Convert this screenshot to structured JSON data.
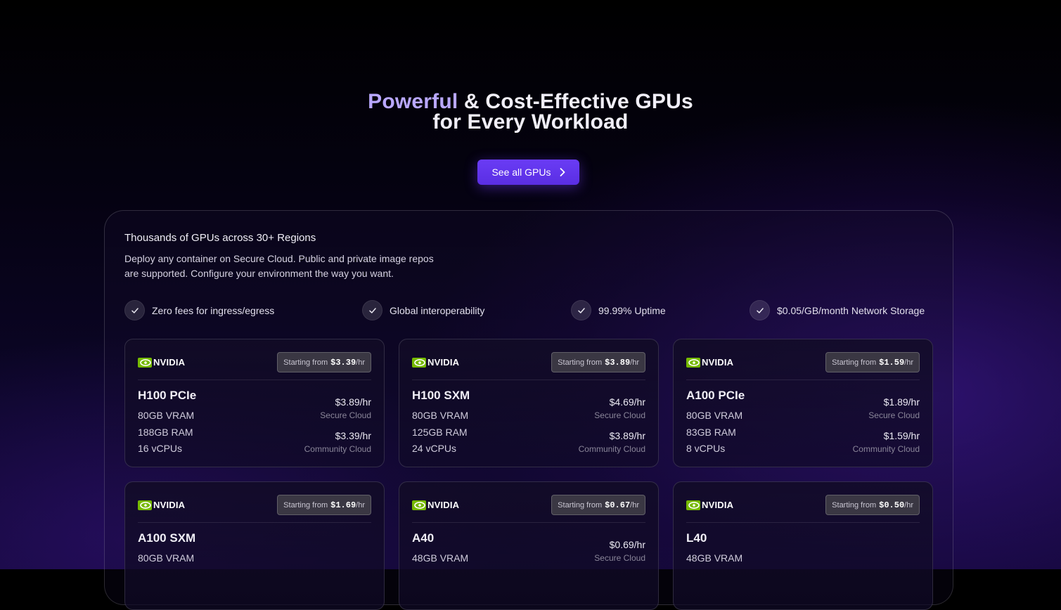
{
  "hero": {
    "title_accent": "Powerful",
    "title_rest": " & Cost-Effective GPUs",
    "title_line2": "for Every Workload",
    "cta_label": "See all GPUs",
    "cta_icon": "chevron-right-icon"
  },
  "panel": {
    "title": "Thousands of GPUs across 30+ Regions",
    "desc_line1": "Deploy any container on Secure Cloud. Public and private image repos",
    "desc_line2": "are supported. Configure your environment the way you want.",
    "features": [
      {
        "label": "Zero fees for ingress/egress",
        "icon": "check-icon"
      },
      {
        "label": "Global interoperability",
        "icon": "check-icon"
      },
      {
        "label": "99.99% Uptime",
        "icon": "check-icon"
      },
      {
        "label": "$0.05/GB/month Network Storage",
        "icon": "check-icon"
      }
    ]
  },
  "brand": {
    "logo_text": "NVIDIA",
    "logo_icon": "nvidia-eye-icon",
    "logo_color": "#76b900",
    "accent": "#6a3cf5"
  },
  "labels": {
    "starting_from": "Starting from",
    "per_hr": "/hr",
    "secure_cloud": "Secure Cloud",
    "community_cloud": "Community Cloud"
  },
  "gpus": [
    {
      "name": "H100 PCIe",
      "starting_price": "$3.39",
      "vram": "80GB VRAM",
      "ram": "188GB RAM",
      "vcpus": "16 vCPUs",
      "secure_price": "$3.89/hr",
      "community_price": "$3.39/hr"
    },
    {
      "name": "H100 SXM",
      "starting_price": "$3.89",
      "vram": "80GB VRAM",
      "ram": "125GB RAM",
      "vcpus": "24 vCPUs",
      "secure_price": "$4.69/hr",
      "community_price": "$3.89/hr"
    },
    {
      "name": "A100 PCIe",
      "starting_price": "$1.59",
      "vram": "80GB VRAM",
      "ram": "83GB RAM",
      "vcpus": "8 vCPUs",
      "secure_price": "$1.89/hr",
      "community_price": "$1.59/hr"
    },
    {
      "name": "A100 SXM",
      "starting_price": "$1.69",
      "vram": "80GB VRAM"
    },
    {
      "name": "A40",
      "starting_price": "$0.67",
      "vram": "48GB VRAM",
      "secure_price": "$0.69/hr"
    },
    {
      "name": "L40",
      "starting_price": "$0.50",
      "vram": "48GB VRAM"
    }
  ]
}
